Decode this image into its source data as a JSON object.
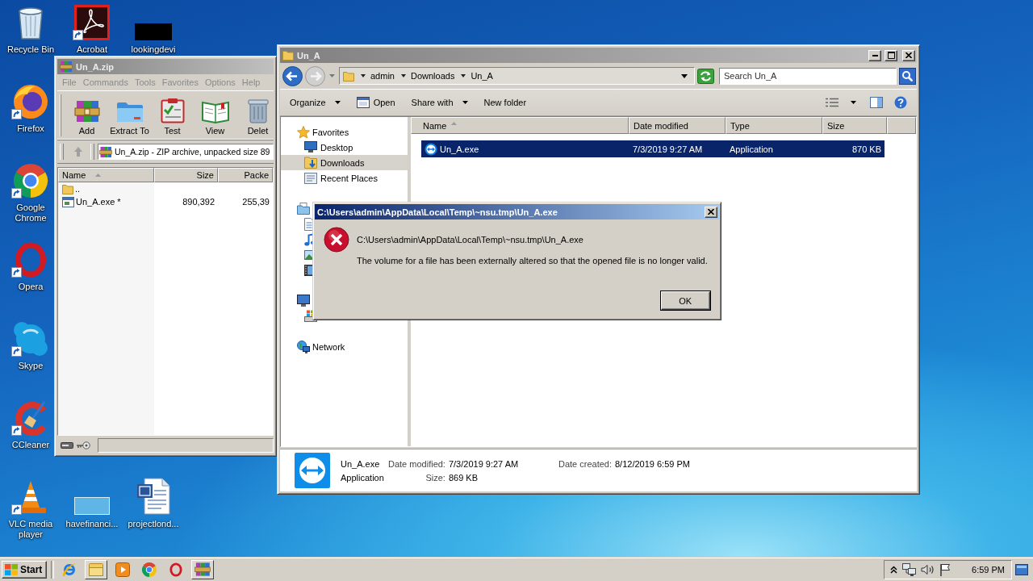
{
  "desktop": {
    "icons": [
      {
        "label": "Recycle Bin",
        "kind": "trash",
        "shortcut": false
      },
      {
        "label": "Acrobat",
        "kind": "pdf",
        "shortcut": true
      },
      {
        "label": "lookingdevi",
        "kind": "redacted",
        "shortcut": false
      },
      {
        "label": "Firefox",
        "kind": "fox",
        "shortcut": true
      },
      {
        "label": "Google Chrome",
        "kind": "wheel",
        "shortcut": true
      },
      {
        "label": "Opera",
        "kind": "oring",
        "shortcut": true
      },
      {
        "label": "Skype",
        "kind": "cloud",
        "shortcut": true
      },
      {
        "label": "CCleaner",
        "kind": "cbrush",
        "shortcut": true
      },
      {
        "label": "VLC media player",
        "kind": "cone",
        "shortcut": true
      },
      {
        "label": "havefinanci...",
        "kind": "blank",
        "shortcut": false
      },
      {
        "label": "projectlond...",
        "kind": "worddoc",
        "shortcut": false
      }
    ]
  },
  "winrar": {
    "title": "Un_A.zip",
    "active": false,
    "menu": [
      {
        "label": "File",
        "disabled": true
      },
      {
        "label": "Commands",
        "disabled": true
      },
      {
        "label": "Tools",
        "disabled": true
      },
      {
        "label": "Favorites",
        "disabled": true
      },
      {
        "label": "Options",
        "disabled": true
      },
      {
        "label": "Help",
        "disabled": true
      }
    ],
    "toolbar": [
      {
        "label": "Add",
        "kind": "add"
      },
      {
        "label": "Extract To",
        "kind": "extract"
      },
      {
        "label": "Test",
        "kind": "test"
      },
      {
        "label": "View",
        "kind": "view"
      },
      {
        "label": "Delet",
        "kind": "delete"
      }
    ],
    "address": "Un_A.zip - ZIP archive, unpacked size 89",
    "columns": [
      {
        "label": "Name",
        "sorted": true
      },
      {
        "label": "Size",
        "sorted": false
      },
      {
        "label": "Packe",
        "sorted": false
      }
    ],
    "rows": [
      {
        "kind": "up",
        "name": ".."
      },
      {
        "kind": "exe",
        "name": "Un_A.exe *",
        "size": "890,392",
        "packed": "255,39"
      }
    ]
  },
  "explorer": {
    "title": "Un_A",
    "active": false,
    "breadcrumb": [
      "admin",
      "Downloads",
      "Un_A"
    ],
    "search": {
      "placeholder": "Search Un_A"
    },
    "commands": [
      {
        "label": "Organize",
        "kind": "plain",
        "dropdown": true
      },
      {
        "label": "Open",
        "kind": "open",
        "dropdown": false
      },
      {
        "label": "Share with",
        "kind": "plain",
        "dropdown": true
      },
      {
        "label": "New folder",
        "kind": "plain",
        "dropdown": false
      }
    ],
    "nav": [
      {
        "label": "Favorites",
        "kind": "star",
        "selected": false,
        "children": [
          {
            "label": "Desktop",
            "kind": "desktop",
            "selected": false
          },
          {
            "label": "Downloads",
            "kind": "downloads",
            "selected": true
          },
          {
            "label": "Recent Places",
            "kind": "recent",
            "selected": false
          }
        ]
      },
      {
        "kind": "library",
        "children": [
          {
            "kind": "documents"
          },
          {
            "kind": "music"
          },
          {
            "kind": "pictures"
          },
          {
            "kind": "videos"
          }
        ]
      },
      {
        "kind": "computer",
        "children": [
          {
            "kind": "drive"
          }
        ]
      },
      {
        "label": "Network",
        "kind": "network",
        "selected": false
      }
    ],
    "columns": [
      {
        "label": "Name",
        "sorted": true
      },
      {
        "label": "Date modified",
        "sorted": false
      },
      {
        "label": "Type",
        "sorted": false
      },
      {
        "label": "Size",
        "sorted": false
      }
    ],
    "rows": [
      {
        "name": "Un_A.exe",
        "modified": "7/3/2019 9:27 AM",
        "type": "Application",
        "size": "870 KB",
        "selected": true
      }
    ],
    "details": {
      "name": "Un_A.exe",
      "type": "Application",
      "modified_label": "Date modified:",
      "modified": "7/3/2019 9:27 AM",
      "created_label": "Date created:",
      "created": "8/12/2019 6:59 PM",
      "size_label": "Size:",
      "size": "869 KB"
    }
  },
  "dialog": {
    "title": "C:\\Users\\admin\\AppData\\Local\\Temp\\~nsu.tmp\\Un_A.exe",
    "active": true,
    "kind": "error",
    "path": "C:\\Users\\admin\\AppData\\Local\\Temp\\~nsu.tmp\\Un_A.exe",
    "message": "The volume for a file has been externally altered so that the opened file is no longer valid.",
    "buttons": [
      {
        "label": "OK",
        "default": true
      }
    ]
  },
  "taskbar": {
    "start": "Start",
    "apps": [
      {
        "kind": "ie",
        "running": false
      },
      {
        "kind": "folder",
        "running": true
      },
      {
        "kind": "media",
        "running": false
      },
      {
        "kind": "wheel",
        "running": false
      },
      {
        "kind": "oring",
        "running": false
      },
      {
        "kind": "archive",
        "running": true
      }
    ],
    "clock": "6:59 PM"
  }
}
